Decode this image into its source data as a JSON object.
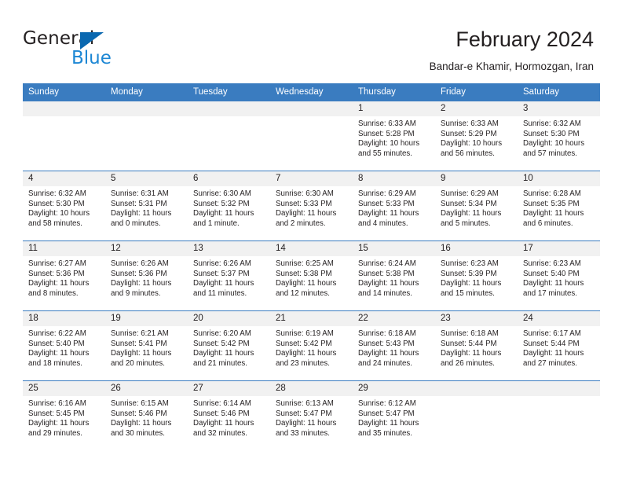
{
  "brand": {
    "name_top": "General",
    "name_bottom": "Blue",
    "accent_color": "#1d87d4",
    "triangle_color": "#0a68b0"
  },
  "header": {
    "title": "February 2024",
    "subtitle": "Bandar-e Khamir, Hormozgan, Iran"
  },
  "calendar": {
    "header_bg": "#3a7cc0",
    "daynum_bg": "#f1f1f1",
    "weekday_headers": [
      "Sunday",
      "Monday",
      "Tuesday",
      "Wednesday",
      "Thursday",
      "Friday",
      "Saturday"
    ],
    "weeks": [
      [
        {
          "day": "",
          "sunrise": "",
          "sunset": "",
          "daylight_1": "",
          "daylight_2": ""
        },
        {
          "day": "",
          "sunrise": "",
          "sunset": "",
          "daylight_1": "",
          "daylight_2": ""
        },
        {
          "day": "",
          "sunrise": "",
          "sunset": "",
          "daylight_1": "",
          "daylight_2": ""
        },
        {
          "day": "",
          "sunrise": "",
          "sunset": "",
          "daylight_1": "",
          "daylight_2": ""
        },
        {
          "day": "1",
          "sunrise": "Sunrise: 6:33 AM",
          "sunset": "Sunset: 5:28 PM",
          "daylight_1": "Daylight: 10 hours",
          "daylight_2": "and 55 minutes."
        },
        {
          "day": "2",
          "sunrise": "Sunrise: 6:33 AM",
          "sunset": "Sunset: 5:29 PM",
          "daylight_1": "Daylight: 10 hours",
          "daylight_2": "and 56 minutes."
        },
        {
          "day": "3",
          "sunrise": "Sunrise: 6:32 AM",
          "sunset": "Sunset: 5:30 PM",
          "daylight_1": "Daylight: 10 hours",
          "daylight_2": "and 57 minutes."
        }
      ],
      [
        {
          "day": "4",
          "sunrise": "Sunrise: 6:32 AM",
          "sunset": "Sunset: 5:30 PM",
          "daylight_1": "Daylight: 10 hours",
          "daylight_2": "and 58 minutes."
        },
        {
          "day": "5",
          "sunrise": "Sunrise: 6:31 AM",
          "sunset": "Sunset: 5:31 PM",
          "daylight_1": "Daylight: 11 hours",
          "daylight_2": "and 0 minutes."
        },
        {
          "day": "6",
          "sunrise": "Sunrise: 6:30 AM",
          "sunset": "Sunset: 5:32 PM",
          "daylight_1": "Daylight: 11 hours",
          "daylight_2": "and 1 minute."
        },
        {
          "day": "7",
          "sunrise": "Sunrise: 6:30 AM",
          "sunset": "Sunset: 5:33 PM",
          "daylight_1": "Daylight: 11 hours",
          "daylight_2": "and 2 minutes."
        },
        {
          "day": "8",
          "sunrise": "Sunrise: 6:29 AM",
          "sunset": "Sunset: 5:33 PM",
          "daylight_1": "Daylight: 11 hours",
          "daylight_2": "and 4 minutes."
        },
        {
          "day": "9",
          "sunrise": "Sunrise: 6:29 AM",
          "sunset": "Sunset: 5:34 PM",
          "daylight_1": "Daylight: 11 hours",
          "daylight_2": "and 5 minutes."
        },
        {
          "day": "10",
          "sunrise": "Sunrise: 6:28 AM",
          "sunset": "Sunset: 5:35 PM",
          "daylight_1": "Daylight: 11 hours",
          "daylight_2": "and 6 minutes."
        }
      ],
      [
        {
          "day": "11",
          "sunrise": "Sunrise: 6:27 AM",
          "sunset": "Sunset: 5:36 PM",
          "daylight_1": "Daylight: 11 hours",
          "daylight_2": "and 8 minutes."
        },
        {
          "day": "12",
          "sunrise": "Sunrise: 6:26 AM",
          "sunset": "Sunset: 5:36 PM",
          "daylight_1": "Daylight: 11 hours",
          "daylight_2": "and 9 minutes."
        },
        {
          "day": "13",
          "sunrise": "Sunrise: 6:26 AM",
          "sunset": "Sunset: 5:37 PM",
          "daylight_1": "Daylight: 11 hours",
          "daylight_2": "and 11 minutes."
        },
        {
          "day": "14",
          "sunrise": "Sunrise: 6:25 AM",
          "sunset": "Sunset: 5:38 PM",
          "daylight_1": "Daylight: 11 hours",
          "daylight_2": "and 12 minutes."
        },
        {
          "day": "15",
          "sunrise": "Sunrise: 6:24 AM",
          "sunset": "Sunset: 5:38 PM",
          "daylight_1": "Daylight: 11 hours",
          "daylight_2": "and 14 minutes."
        },
        {
          "day": "16",
          "sunrise": "Sunrise: 6:23 AM",
          "sunset": "Sunset: 5:39 PM",
          "daylight_1": "Daylight: 11 hours",
          "daylight_2": "and 15 minutes."
        },
        {
          "day": "17",
          "sunrise": "Sunrise: 6:23 AM",
          "sunset": "Sunset: 5:40 PM",
          "daylight_1": "Daylight: 11 hours",
          "daylight_2": "and 17 minutes."
        }
      ],
      [
        {
          "day": "18",
          "sunrise": "Sunrise: 6:22 AM",
          "sunset": "Sunset: 5:40 PM",
          "daylight_1": "Daylight: 11 hours",
          "daylight_2": "and 18 minutes."
        },
        {
          "day": "19",
          "sunrise": "Sunrise: 6:21 AM",
          "sunset": "Sunset: 5:41 PM",
          "daylight_1": "Daylight: 11 hours",
          "daylight_2": "and 20 minutes."
        },
        {
          "day": "20",
          "sunrise": "Sunrise: 6:20 AM",
          "sunset": "Sunset: 5:42 PM",
          "daylight_1": "Daylight: 11 hours",
          "daylight_2": "and 21 minutes."
        },
        {
          "day": "21",
          "sunrise": "Sunrise: 6:19 AM",
          "sunset": "Sunset: 5:42 PM",
          "daylight_1": "Daylight: 11 hours",
          "daylight_2": "and 23 minutes."
        },
        {
          "day": "22",
          "sunrise": "Sunrise: 6:18 AM",
          "sunset": "Sunset: 5:43 PM",
          "daylight_1": "Daylight: 11 hours",
          "daylight_2": "and 24 minutes."
        },
        {
          "day": "23",
          "sunrise": "Sunrise: 6:18 AM",
          "sunset": "Sunset: 5:44 PM",
          "daylight_1": "Daylight: 11 hours",
          "daylight_2": "and 26 minutes."
        },
        {
          "day": "24",
          "sunrise": "Sunrise: 6:17 AM",
          "sunset": "Sunset: 5:44 PM",
          "daylight_1": "Daylight: 11 hours",
          "daylight_2": "and 27 minutes."
        }
      ],
      [
        {
          "day": "25",
          "sunrise": "Sunrise: 6:16 AM",
          "sunset": "Sunset: 5:45 PM",
          "daylight_1": "Daylight: 11 hours",
          "daylight_2": "and 29 minutes."
        },
        {
          "day": "26",
          "sunrise": "Sunrise: 6:15 AM",
          "sunset": "Sunset: 5:46 PM",
          "daylight_1": "Daylight: 11 hours",
          "daylight_2": "and 30 minutes."
        },
        {
          "day": "27",
          "sunrise": "Sunrise: 6:14 AM",
          "sunset": "Sunset: 5:46 PM",
          "daylight_1": "Daylight: 11 hours",
          "daylight_2": "and 32 minutes."
        },
        {
          "day": "28",
          "sunrise": "Sunrise: 6:13 AM",
          "sunset": "Sunset: 5:47 PM",
          "daylight_1": "Daylight: 11 hours",
          "daylight_2": "and 33 minutes."
        },
        {
          "day": "29",
          "sunrise": "Sunrise: 6:12 AM",
          "sunset": "Sunset: 5:47 PM",
          "daylight_1": "Daylight: 11 hours",
          "daylight_2": "and 35 minutes."
        },
        {
          "day": "",
          "sunrise": "",
          "sunset": "",
          "daylight_1": "",
          "daylight_2": ""
        },
        {
          "day": "",
          "sunrise": "",
          "sunset": "",
          "daylight_1": "",
          "daylight_2": ""
        }
      ]
    ]
  }
}
